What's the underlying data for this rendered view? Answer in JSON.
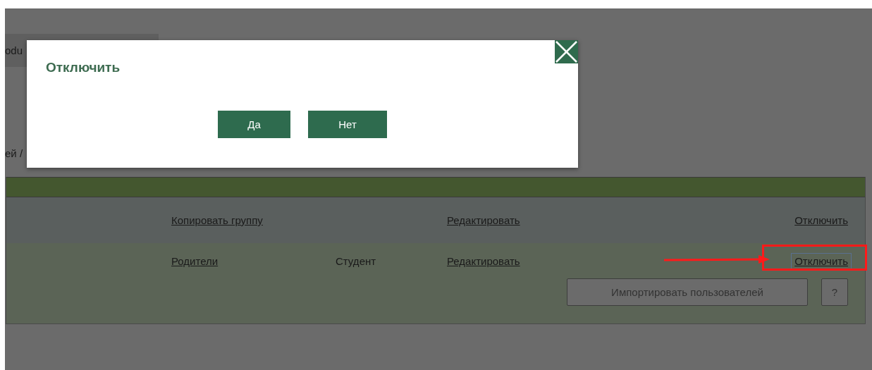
{
  "background_tab": {
    "label": "odu"
  },
  "breadcrumb": {
    "text": "ей /"
  },
  "table": {
    "rows": [
      {
        "group_link": "Копировать группу",
        "edit_link": "Редактировать",
        "disable_link": {
          "label": "Отключить",
          "focused": false,
          "annotated": false
        }
      },
      {
        "group_link": "Родители",
        "role": "Студент",
        "edit_link": "Редактировать",
        "disable_link": {
          "label": "Отключить",
          "focused": true,
          "annotated": true
        }
      }
    ]
  },
  "import_button": {
    "label": "Импортировать пользователей"
  },
  "help_button": {
    "label": "?"
  },
  "dialog": {
    "title": "Отключить",
    "buttons": [
      "Да",
      "Нет"
    ]
  }
}
